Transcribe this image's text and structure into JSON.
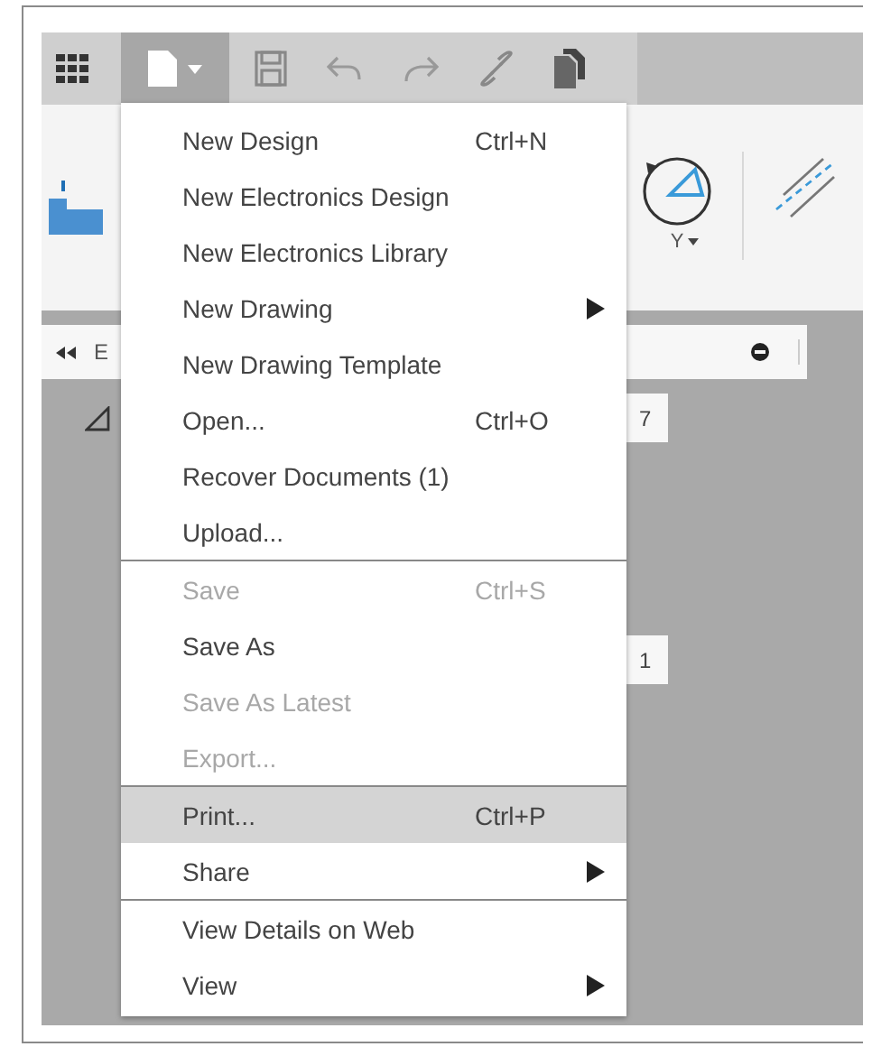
{
  "toolbar": {
    "file_button": {
      "expanded": true
    }
  },
  "ribbon": {
    "label_fragment": "Y"
  },
  "browser_bar": {
    "label_fragment": "E"
  },
  "canvas": {
    "fields": [
      "7",
      "1"
    ]
  },
  "file_menu": {
    "items": [
      {
        "label": "New Design",
        "shortcut": "Ctrl+N",
        "submenu": false,
        "disabled": false,
        "selected": false,
        "separator_after": false
      },
      {
        "label": "New Electronics Design",
        "submenu": false,
        "disabled": false,
        "selected": false,
        "separator_after": false
      },
      {
        "label": "New Electronics Library",
        "submenu": false,
        "disabled": false,
        "selected": false,
        "separator_after": false
      },
      {
        "label": "New Drawing",
        "submenu": true,
        "disabled": false,
        "selected": false,
        "separator_after": false
      },
      {
        "label": "New Drawing Template",
        "submenu": false,
        "disabled": false,
        "selected": false,
        "separator_after": false
      },
      {
        "label": "Open...",
        "shortcut": "Ctrl+O",
        "submenu": false,
        "disabled": false,
        "selected": false,
        "separator_after": false
      },
      {
        "label": "Recover Documents (1)",
        "submenu": false,
        "disabled": false,
        "selected": false,
        "separator_after": false
      },
      {
        "label": "Upload...",
        "submenu": false,
        "disabled": false,
        "selected": false,
        "separator_after": true
      },
      {
        "label": "Save",
        "shortcut": "Ctrl+S",
        "submenu": false,
        "disabled": true,
        "selected": false,
        "separator_after": false
      },
      {
        "label": "Save As",
        "submenu": false,
        "disabled": false,
        "selected": false,
        "separator_after": false
      },
      {
        "label": "Save As Latest",
        "submenu": false,
        "disabled": true,
        "selected": false,
        "separator_after": false
      },
      {
        "label": "Export...",
        "submenu": false,
        "disabled": true,
        "selected": false,
        "separator_after": true
      },
      {
        "label": "Print...",
        "shortcut": "Ctrl+P",
        "submenu": false,
        "disabled": false,
        "selected": true,
        "separator_after": false
      },
      {
        "label": "Share",
        "submenu": true,
        "disabled": false,
        "selected": false,
        "separator_after": true
      },
      {
        "label": "View Details on Web",
        "submenu": false,
        "disabled": false,
        "selected": false,
        "separator_after": false
      },
      {
        "label": "View",
        "submenu": true,
        "disabled": false,
        "selected": false,
        "separator_after": false
      }
    ]
  }
}
